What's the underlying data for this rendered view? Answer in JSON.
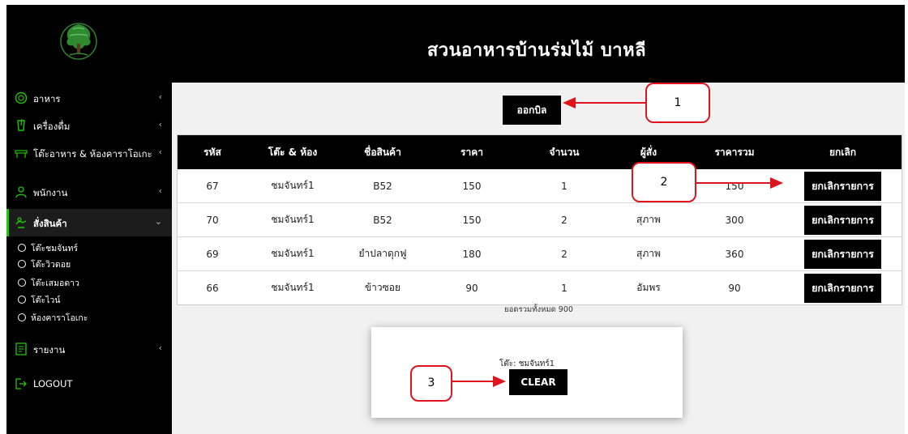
{
  "header": {
    "title": "สวนอาหารบ้านร่มไม้ บาหลี"
  },
  "sidebar": {
    "items": [
      {
        "label": "อาหาร",
        "icon": "food-icon"
      },
      {
        "label": "เครื่องดื่ม",
        "icon": "drink-icon"
      },
      {
        "label": "โต๊ะอาหาร & ห้องคาราโอเกะ",
        "icon": "table-icon"
      },
      {
        "label": "พนักงาน",
        "icon": "staff-icon"
      },
      {
        "label": "สั่งสินค้า",
        "icon": "order-icon",
        "active": true
      },
      {
        "label": "รายงาน",
        "icon": "report-icon"
      },
      {
        "label": "LOGOUT",
        "icon": "logout-icon"
      }
    ],
    "subitems": [
      "โต๊ะชมจันทร์",
      "โต๊ะวิวดอย",
      "โต๊ะเสมอดาว",
      "โต๊ะไวน์",
      "ห้องคาราโอเกะ"
    ]
  },
  "main": {
    "bill_button": "ออกบิล",
    "columns": [
      "รหัส",
      "โต๊ะ & ห้อง",
      "ชื่อสินค้า",
      "ราคา",
      "จำนวน",
      "ผู้สั่ง",
      "ราคารวม",
      "ยกเลิก"
    ],
    "rows": [
      {
        "id": "67",
        "table": "ชมจันทร์1",
        "product": "B52",
        "price": "150",
        "qty": "1",
        "orderer": "",
        "total": "150",
        "cancel": "ยกเลิกรายการ"
      },
      {
        "id": "70",
        "table": "ชมจันทร์1",
        "product": "B52",
        "price": "150",
        "qty": "2",
        "orderer": "สุภาพ",
        "total": "300",
        "cancel": "ยกเลิกรายการ"
      },
      {
        "id": "69",
        "table": "ชมจันทร์1",
        "product": "ยำปลาดุกฟู",
        "price": "180",
        "qty": "2",
        "orderer": "สุภาพ",
        "total": "360",
        "cancel": "ยกเลิกรายการ"
      },
      {
        "id": "66",
        "table": "ชมจันทร์1",
        "product": "ข้าวซอย",
        "price": "90",
        "qty": "1",
        "orderer": "อัมพร",
        "total": "90",
        "cancel": "ยกเลิกรายการ"
      }
    ],
    "grand_total": "ยอดรวมทั้งหมด 900",
    "card": {
      "title": "โต๊ะ: ชมจันทร์1",
      "clear_button": "CLEAR"
    }
  },
  "annotations": [
    "1",
    "2",
    "3"
  ],
  "colors": {
    "accent": "#1ec800",
    "annotation": "#e0141e",
    "dark": "#000000"
  }
}
